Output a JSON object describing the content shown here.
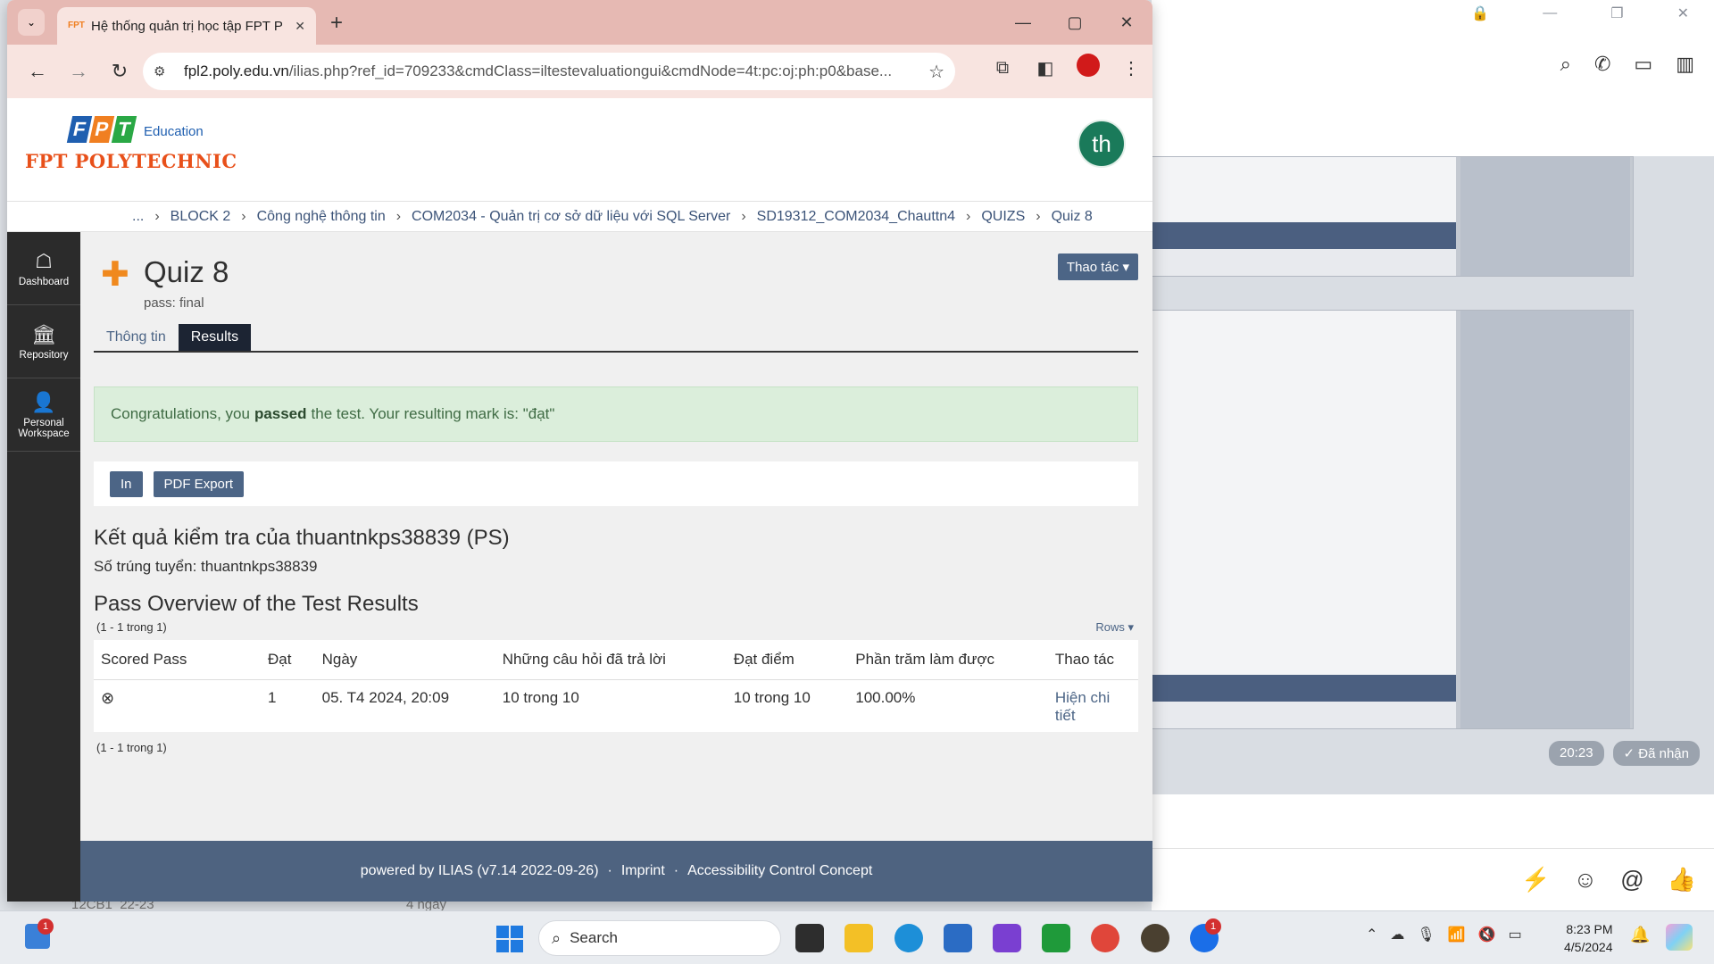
{
  "browser": {
    "tab_title": "Hệ thống quản trị học tập FPT P",
    "url_host": "fpl2.poly.edu.vn",
    "url_path": "/ilias.php?ref_id=709233&cmdClass=iltestevaluationgui&cmdNode=4t:pc:oj:ph:p0&base..."
  },
  "header": {
    "logo_edu": "Education",
    "logo_poly": "FPT POLYTECHNIC",
    "avatar_initials": "th"
  },
  "breadcrumb": [
    "...",
    "BLOCK 2",
    "Công nghệ thông tin",
    "COM2034 - Quản trị cơ sở dữ liệu với SQL Server",
    "SD19312_COM2034_Chauttn4",
    "QUIZS",
    "Quiz 8"
  ],
  "mainbar": [
    {
      "label": "Dashboard",
      "icon": "dashboard-icon"
    },
    {
      "label": "Repository",
      "icon": "repository-icon"
    },
    {
      "label": "Personal Workspace",
      "icon": "person-icon"
    }
  ],
  "quiz": {
    "title": "Quiz 8",
    "subtitle": "pass: final",
    "actions_label": "Thao tác ▾"
  },
  "tabs": [
    "Thông tin",
    "Results"
  ],
  "alert": {
    "before": "Congratulations, you",
    "bold": "passed",
    "after": "the test. Your resulting mark is: \"đạt\""
  },
  "buttons": {
    "print": "In",
    "pdf": "PDF Export"
  },
  "result": {
    "heading": "Kết quả kiểm tra của thuantnkps38839 (PS)",
    "matric": "Số trúng tuyển: thuantnkps38839",
    "pass_heading": "Pass Overview of the Test Results",
    "count": "(1 - 1 trong 1)",
    "rows_label": "Rows ▾"
  },
  "table": {
    "headers": [
      "Scored Pass",
      "Đạt",
      "Ngày",
      "Những câu hỏi đã trả lời",
      "Đạt điểm",
      "Phần trăm làm được",
      "Thao tác"
    ],
    "row": [
      "⊗",
      "1",
      "05. T4 2024, 20:09",
      "10 trong 10",
      "10 trong 10",
      "100.00%",
      "Hiện chi tiết"
    ]
  },
  "footer": {
    "powered": "powered by ILIAS (v7.14 2022-09-26)",
    "imprint": "Imprint",
    "accessibility": "Accessibility Control Concept"
  },
  "background_chat": {
    "time": "20:23",
    "status": "✓ Đã nhận",
    "under_left": "12CB1_22-23",
    "under_right": "4 ngày"
  },
  "taskbar": {
    "search_placeholder": "Search",
    "time": "8:23 PM",
    "date": "4/5/2024",
    "badge_count": "1"
  },
  "colors": {
    "tabstrip": "#e6b9b3",
    "ilias_blue": "#4c6586",
    "mainbar": "#2b2b2b",
    "success_bg": "#dbeedb"
  }
}
